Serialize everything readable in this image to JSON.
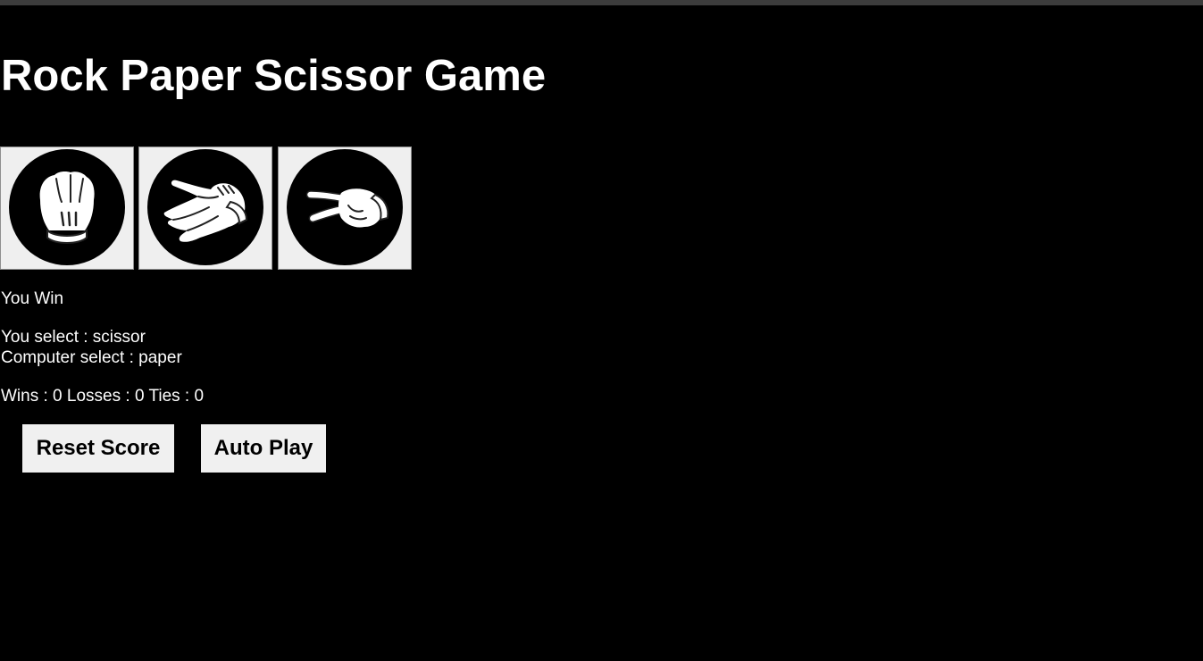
{
  "game": {
    "title": "Rock Paper Scissor Game"
  },
  "moves": [
    {
      "name": "rock",
      "icon": "rock-hand-icon"
    },
    {
      "name": "paper",
      "icon": "paper-hand-icon"
    },
    {
      "name": "scissor",
      "icon": "scissor-hand-icon"
    }
  ],
  "result": {
    "text": "You Win",
    "player_line": "You select : scissor",
    "computer_line": "Computer select : paper"
  },
  "score": {
    "text": "Wins : 0 Losses : 0 Ties : 0",
    "wins": 0,
    "losses": 0,
    "ties": 0
  },
  "controls": {
    "reset_label": "Reset Score",
    "autoplay_label": "Auto Play"
  },
  "colors": {
    "background": "#000000",
    "text": "#ffffff",
    "button_background": "#efefef",
    "glove": "#ffffff"
  }
}
